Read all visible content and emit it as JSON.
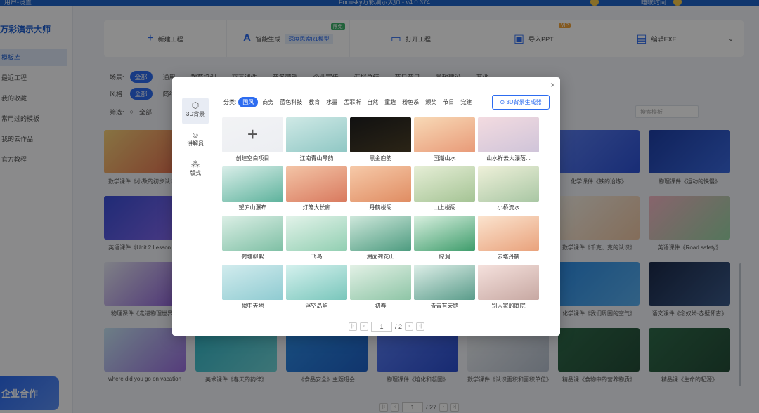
{
  "titlebar": {
    "left_text": "用户-设置",
    "center_text": "Focusky万彩演示大师 - v4.0.374",
    "right_user": "睡眠时间"
  },
  "sidebar": {
    "brand": "万彩演示大师",
    "items": [
      {
        "label": "模板库",
        "active": true
      },
      {
        "label": "最近工程",
        "active": false
      },
      {
        "label": "我的收藏",
        "active": false
      },
      {
        "label": "常用过的模板",
        "active": false
      },
      {
        "label": "我的云作品",
        "active": false
      },
      {
        "label": "官方教程",
        "active": false
      }
    ],
    "banner": "企业合作"
  },
  "actions": [
    {
      "icon": "plus-icon",
      "label": "新建工程"
    },
    {
      "icon": "ai-icon",
      "label": "智能生成",
      "tag": "深度思索R1模型",
      "badge": "限免"
    },
    {
      "icon": "folder-icon",
      "label": "打开工程"
    },
    {
      "icon": "ppt-icon",
      "label": "导入PPT",
      "badge": "VIP"
    },
    {
      "icon": "exe-icon",
      "label": "编辑EXE"
    },
    {
      "icon": "chevron-down-icon",
      "label": ""
    }
  ],
  "filters": {
    "scene_label": "场景:",
    "scene": [
      "全部",
      "通用",
      "教育培训",
      "交互课件",
      "商务营销",
      "企业宣传",
      "汇报总结",
      "节日节日",
      "党政建设",
      "其他"
    ],
    "style_label": "风格:",
    "style": [
      "全部",
      "简约"
    ],
    "sort_label": "筛选:",
    "sort": [
      "全部"
    ],
    "search_placeholder": "搜索模板"
  },
  "background_cards": [
    {
      "caption": "数学课件《小数的初步认识》"
    },
    {
      "caption": "英语课件《Unit 2 Lesson 2》"
    },
    {
      "caption": "物理课件《走进物理世界》"
    },
    {
      "caption": "where did you go on vacation"
    },
    {
      "caption": "美术课件《春天的韵律》"
    },
    {
      "caption": "《食品安全》主题班会"
    },
    {
      "caption": "物理课件《熔化和凝固》"
    },
    {
      "caption": "数学课件《认识面积和面积单位》"
    },
    {
      "caption": "精品课《食物中的营养物质》"
    },
    {
      "caption": "精品课《生命的起源》"
    },
    {
      "caption": "化学课件《铁的冶炼》"
    },
    {
      "caption": "物理课件《运动的快慢》"
    },
    {
      "caption": "数学课件《千克、克的认识》"
    },
    {
      "caption": "英语课件《Road safety》"
    },
    {
      "caption": "化学课件《我们周围的空气》"
    },
    {
      "caption": "语文课件《念奴娇·赤壁怀古》"
    }
  ],
  "main_pager": {
    "current": "1",
    "total": "/ 27"
  },
  "modal": {
    "close": "×",
    "side_tabs": [
      {
        "icon": "cube-icon",
        "label": "3D背景",
        "active": true
      },
      {
        "icon": "presenter-icon",
        "label": "讲解员",
        "active": false
      },
      {
        "icon": "layout-icon",
        "label": "版式",
        "active": false
      }
    ],
    "category_label": "分类:",
    "categories": [
      "国风",
      "商务",
      "蓝色科技",
      "教育",
      "水墨",
      "孟菲斯",
      "自然",
      "童趣",
      "粉色系",
      "颁奖",
      "节日",
      "党建"
    ],
    "generate_button": "3D背景生成器",
    "templates": [
      {
        "caption": "创建空白项目",
        "colors": [
          "#f2f3f5",
          "#eceef2"
        ],
        "blank": true
      },
      {
        "caption": "江南青山琴韵",
        "colors": [
          "#cfe9e6",
          "#8fc7c4"
        ]
      },
      {
        "caption": "黑金鹿韵",
        "colors": [
          "#111111",
          "#2b2416"
        ]
      },
      {
        "caption": "国潮山水",
        "colors": [
          "#f8d9b6",
          "#e89a78"
        ]
      },
      {
        "caption": "山水祥云大瀑落...",
        "colors": [
          "#f3dbe0",
          "#cfc4d9"
        ]
      },
      {
        "caption": "望庐山瀑布",
        "colors": [
          "#d9eee9",
          "#5fb39d"
        ]
      },
      {
        "caption": "灯笼大长廊",
        "colors": [
          "#f3c4a6",
          "#d97a5f"
        ]
      },
      {
        "caption": "丹鹤楼阁",
        "colors": [
          "#f6c9a8",
          "#e08d63"
        ]
      },
      {
        "caption": "山上楼阁",
        "colors": [
          "#e6eed6",
          "#a5c495"
        ]
      },
      {
        "caption": "小桥流水",
        "colors": [
          "#eef0d9",
          "#a9c7a4"
        ]
      },
      {
        "caption": "荷塘柳絮",
        "colors": [
          "#dcefe6",
          "#7fc0a5"
        ]
      },
      {
        "caption": "飞鸟",
        "colors": [
          "#e3f3ea",
          "#92cfb2"
        ]
      },
      {
        "caption": "湖面荷花山",
        "colors": [
          "#cfe8dc",
          "#4e9c80"
        ]
      },
      {
        "caption": "绿洞",
        "colors": [
          "#d9f0e0",
          "#3f9d6c"
        ]
      },
      {
        "caption": "云塔丹鹤",
        "colors": [
          "#fbe4cf",
          "#e9a27c"
        ]
      },
      {
        "caption": "瞬中天地",
        "colors": [
          "#d2ecee",
          "#8fcbd1"
        ]
      },
      {
        "caption": "浮空岛屿",
        "colors": [
          "#d5f1ee",
          "#79c6bb"
        ]
      },
      {
        "caption": "初春",
        "colors": [
          "#e3f1e6",
          "#8ec5a6"
        ]
      },
      {
        "caption": "青青有天鹅",
        "colors": [
          "#ddeee8",
          "#5a9c8a"
        ]
      },
      {
        "caption": "别人家的庭院",
        "colors": [
          "#f5e1dd",
          "#c7a8a2"
        ]
      }
    ],
    "pager": {
      "current": "1",
      "total": "/ 2"
    }
  }
}
